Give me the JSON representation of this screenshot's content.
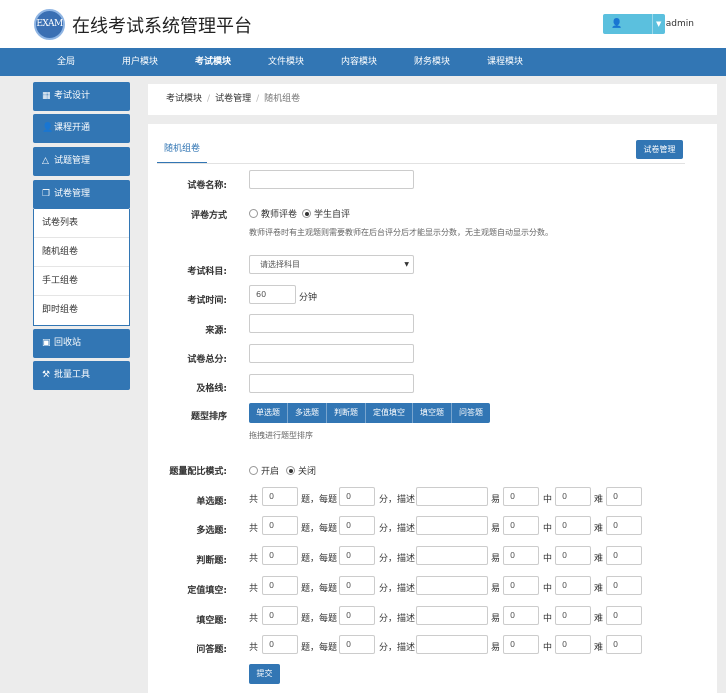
{
  "header": {
    "logo_text": "EXAM",
    "title": "在线考试系统管理平台",
    "user_label": "admin"
  },
  "nav": [
    "全局",
    "用户模块",
    "考试模块",
    "文件模块",
    "内容模块",
    "财务模块",
    "课程模块"
  ],
  "nav_active": "考试模块",
  "sidebar": {
    "groups": [
      {
        "label": "考试设计",
        "icon": "grid-icon"
      },
      {
        "label": "课程开通",
        "icon": "user-icon"
      },
      {
        "label": "试题管理",
        "icon": "warning-icon"
      },
      {
        "label": "试卷管理",
        "icon": "copy-icon"
      },
      {
        "label": "回收站",
        "icon": "trash-icon"
      },
      {
        "label": "批量工具",
        "icon": "wrench-icon"
      }
    ],
    "sub_items": [
      "试卷列表",
      "随机组卷",
      "手工组卷",
      "即时组卷"
    ]
  },
  "breadcrumb": [
    "考试模块",
    "试卷管理",
    "随机组卷"
  ],
  "tab": "随机组卷",
  "manage_button": "试卷管理",
  "form": {
    "paper_name_label": "试卷名称:",
    "grading_label": "评卷方式",
    "grading_options": [
      "教师评卷",
      "学生自评"
    ],
    "grading_selected": "学生自评",
    "grading_hint": "教师评卷时有主观题则需要教师在后台评分后才能显示分数，无主观题自动显示分数。",
    "subject_label": "考试科目:",
    "subject_placeholder": "请选择科目",
    "time_label": "考试时间:",
    "time_value": "60",
    "time_unit": "分钟",
    "source_label": "来源:",
    "total_label": "试卷总分:",
    "pass_label": "及格线:",
    "order_label": "题型排序",
    "question_types": [
      "单选题",
      "多选题",
      "判断题",
      "定值填空",
      "填空题",
      "问答题"
    ],
    "order_hint": "拖拽进行题型排序",
    "ratio_label": "题量配比模式:",
    "ratio_options": [
      "开启",
      "关闭"
    ],
    "ratio_selected": "关闭",
    "row_words": {
      "total": "共",
      "per_a": "题，每题",
      "per_b": "分，描述",
      "easy": "易",
      "mid": "中",
      "hard": "难"
    },
    "rows": [
      {
        "label": "单选题:",
        "count": "0",
        "score": "0",
        "easy": "0",
        "mid": "0",
        "hard": "0"
      },
      {
        "label": "多选题:",
        "count": "0",
        "score": "0",
        "easy": "0",
        "mid": "0",
        "hard": "0"
      },
      {
        "label": "判断题:",
        "count": "0",
        "score": "0",
        "easy": "0",
        "mid": "0",
        "hard": "0"
      },
      {
        "label": "定值填空:",
        "count": "0",
        "score": "0",
        "easy": "0",
        "mid": "0",
        "hard": "0"
      },
      {
        "label": "填空题:",
        "count": "0",
        "score": "0",
        "easy": "0",
        "mid": "0",
        "hard": "0"
      },
      {
        "label": "问答题:",
        "count": "0",
        "score": "0",
        "easy": "0",
        "mid": "0",
        "hard": "0"
      }
    ],
    "submit_label": "提交"
  }
}
